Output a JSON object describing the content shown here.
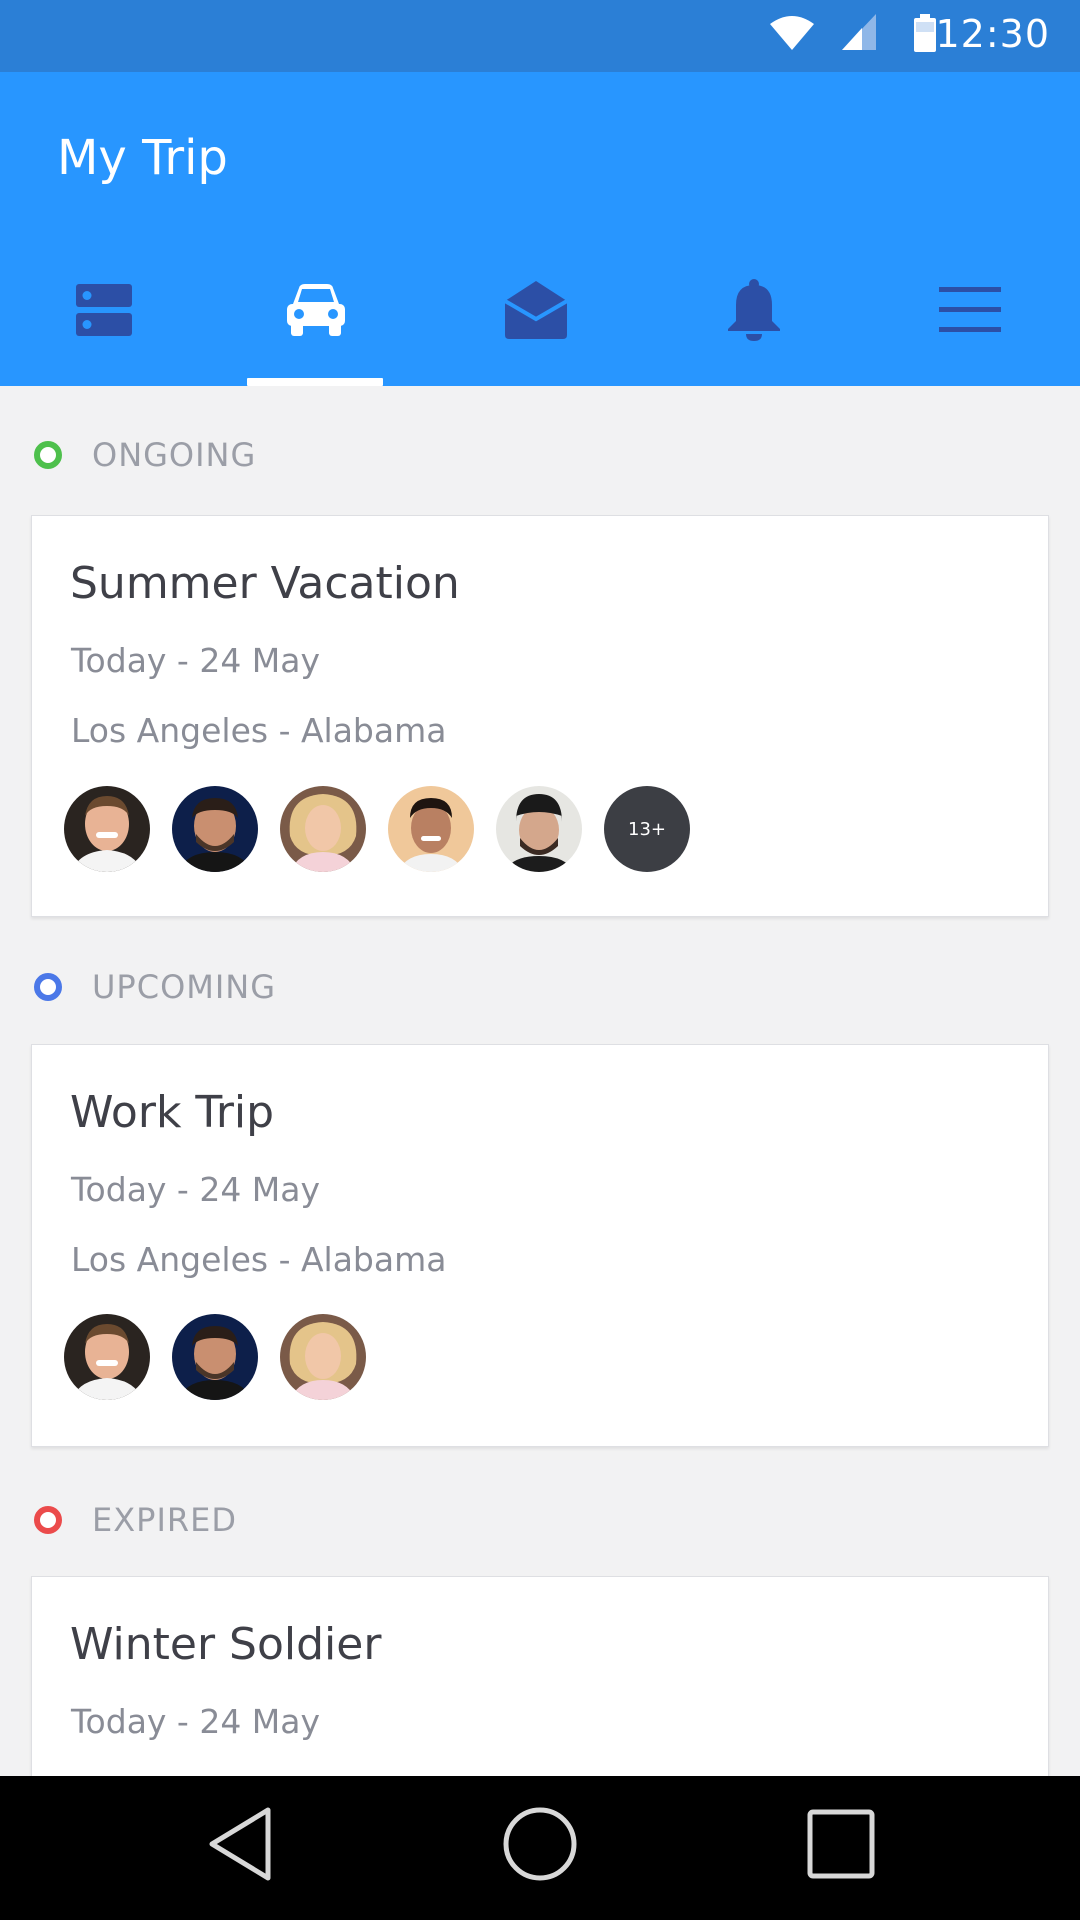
{
  "status": {
    "time": "12:30"
  },
  "app": {
    "title": "My Trip"
  },
  "tabs": [
    {
      "icon": "server-icon",
      "active": false
    },
    {
      "icon": "car-icon",
      "active": true
    },
    {
      "icon": "mail-open-icon",
      "active": false
    },
    {
      "icon": "bell-icon",
      "active": false
    },
    {
      "icon": "menu-icon",
      "active": false
    }
  ],
  "sections": [
    {
      "label": "ONGOING",
      "color": "#4ec04c",
      "trip": {
        "title": "Summer Vacation",
        "dates": "Today - 24 May",
        "route": "Los Angeles - Alabama",
        "more": "13+"
      }
    },
    {
      "label": "UPCOMING",
      "color": "#4b78e8",
      "trip": {
        "title": "Work Trip",
        "dates": "Today - 24 May",
        "route": "Los Angeles - Alabama"
      }
    },
    {
      "label": "EXPIRED",
      "color": "#eb4b4b",
      "trip": {
        "title": "Winter Soldier",
        "dates": "Today - 24 May"
      }
    }
  ],
  "colors": {
    "status_bar": "#2b7fd6",
    "app_bar": "#2896ff",
    "inactive_tab_icon": "#2c4fa6",
    "active_tab_icon": "#ffffff"
  }
}
